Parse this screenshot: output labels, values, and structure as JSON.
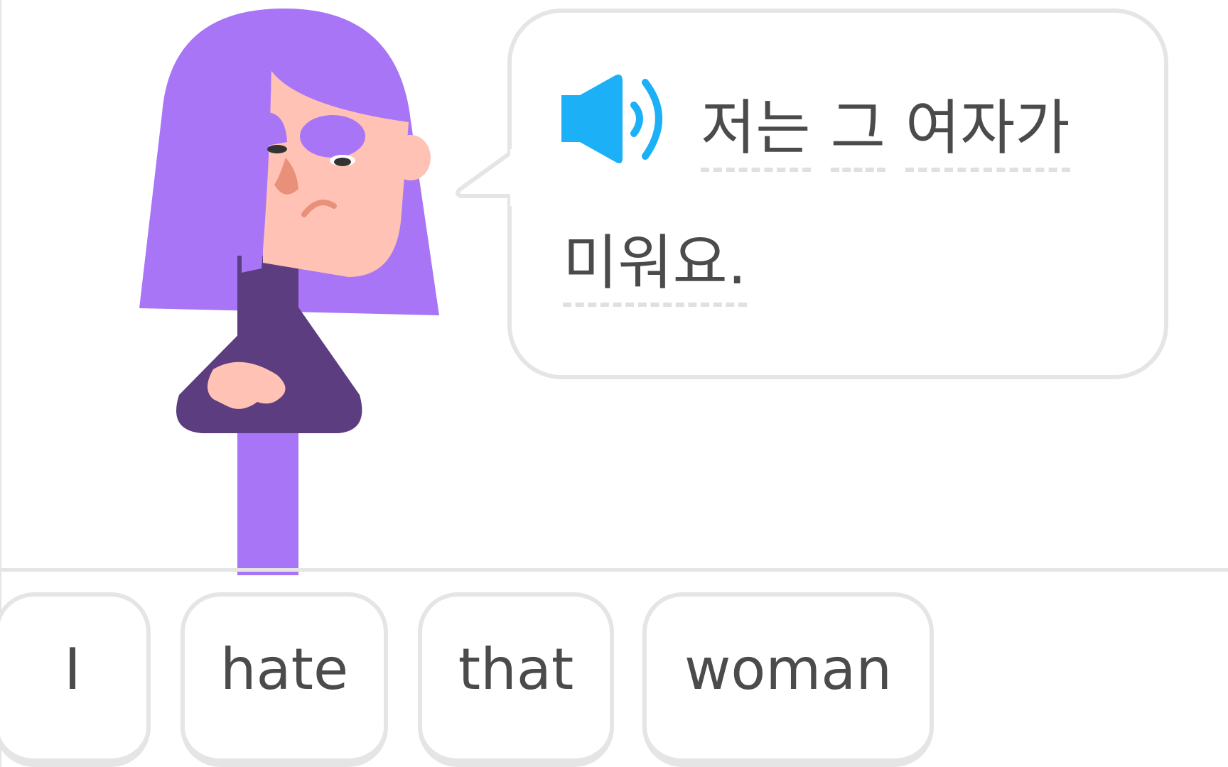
{
  "prompt": {
    "sentence_line1_words": [
      "저는",
      "그",
      "여자가"
    ],
    "sentence_line2_words": [
      "미워요."
    ],
    "speaker_icon": "speaker-icon"
  },
  "word_bank": {
    "tiles": [
      "I",
      "hate",
      "that",
      "woman"
    ]
  },
  "colors": {
    "hair": "#a875f7",
    "skin": "#ffc2b5",
    "shirt": "#5b3d80",
    "speaker": "#1cb0f6",
    "border": "#e5e5e5",
    "text": "#4b4b4b"
  }
}
